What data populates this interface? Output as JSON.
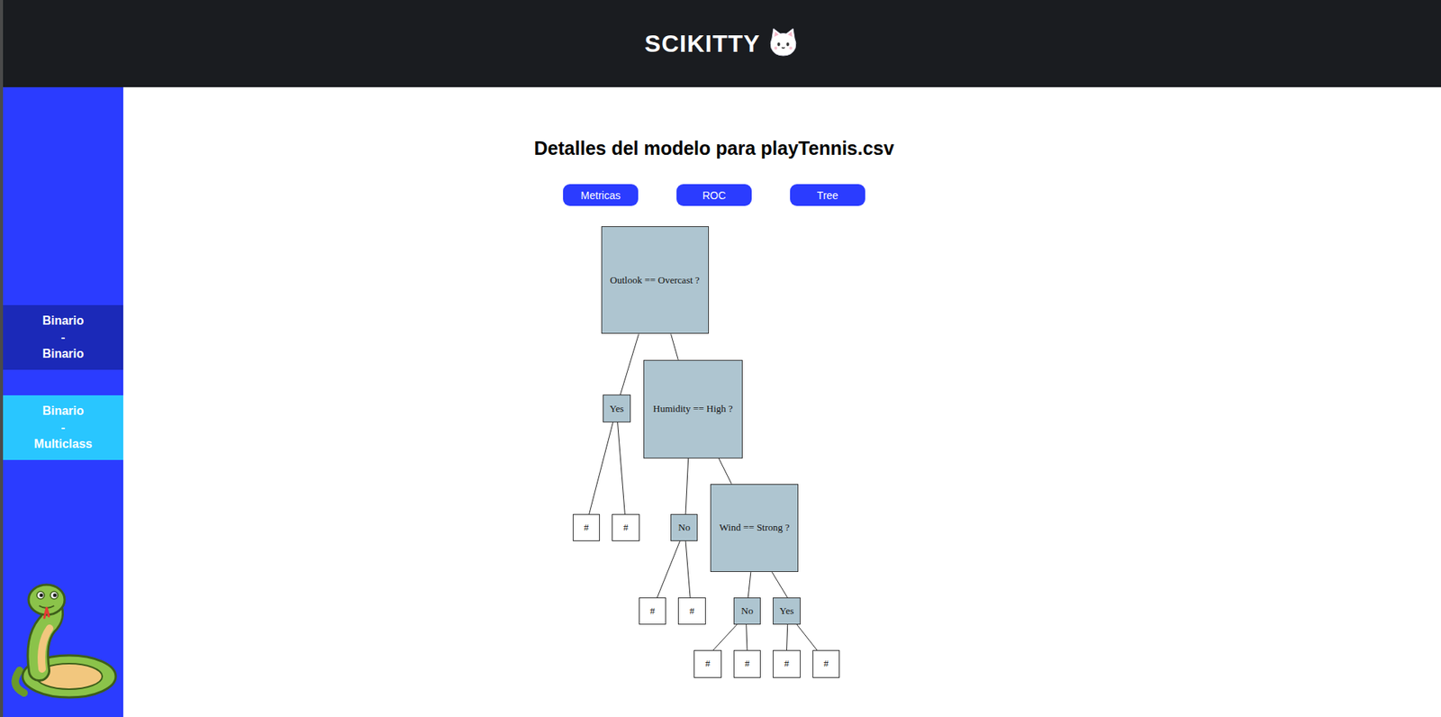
{
  "header": {
    "title": "SCIKITTY"
  },
  "sidebar": {
    "items": [
      {
        "lines": [
          "Binario",
          "-",
          "Binario"
        ],
        "color": "#1b29b8"
      },
      {
        "lines": [
          "Binario",
          "-",
          "Multiclass"
        ],
        "color": "#29c6ff"
      }
    ]
  },
  "page": {
    "title": "Detalles del modelo para playTennis.csv"
  },
  "tabs": [
    {
      "label": "Metricas"
    },
    {
      "label": "ROC"
    },
    {
      "label": "Tree"
    }
  ],
  "tree": {
    "nodes": [
      {
        "label": "Outlook == Overcast ?",
        "kind": "question",
        "parent": null
      },
      {
        "label": "Yes",
        "kind": "answer",
        "parent": 0
      },
      {
        "label": "Humidity == High ?",
        "kind": "question",
        "parent": 0
      },
      {
        "label": "#",
        "kind": "leaf",
        "parent": 1
      },
      {
        "label": "#",
        "kind": "leaf",
        "parent": 1
      },
      {
        "label": "No",
        "kind": "answer",
        "parent": 2
      },
      {
        "label": "Wind == Strong ?",
        "kind": "question",
        "parent": 2
      },
      {
        "label": "#",
        "kind": "leaf",
        "parent": 5
      },
      {
        "label": "#",
        "kind": "leaf",
        "parent": 5
      },
      {
        "label": "No",
        "kind": "answer",
        "parent": 6
      },
      {
        "label": "Yes",
        "kind": "answer",
        "parent": 6
      },
      {
        "label": "#",
        "kind": "leaf",
        "parent": 9
      },
      {
        "label": "#",
        "kind": "leaf",
        "parent": 9
      },
      {
        "label": "#",
        "kind": "leaf",
        "parent": 10
      },
      {
        "label": "#",
        "kind": "leaf",
        "parent": 10
      }
    ]
  }
}
